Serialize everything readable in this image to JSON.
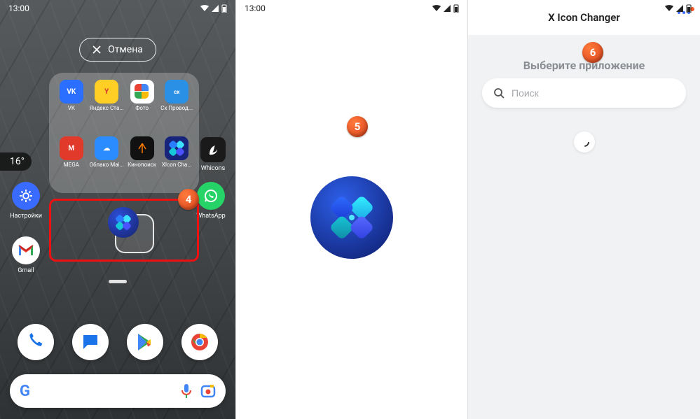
{
  "status": {
    "time": "13:00"
  },
  "panel1": {
    "cancel_label": "Отмена",
    "temperature": "16°",
    "folder_apps": [
      {
        "name": "VK",
        "bg": "#2a6fff"
      },
      {
        "name": "Яндекс Ста...",
        "bg": "#ffcf26"
      },
      {
        "name": "Фото",
        "bg": "#ffffff"
      },
      {
        "name": "Cx Провод...",
        "bg": "#2a90e6"
      },
      {
        "name": "MEGA",
        "bg": "#e23a2a"
      },
      {
        "name": "Облако Mai...",
        "bg": "#2a8cff"
      },
      {
        "name": "Кинопоиск",
        "bg": "#111111"
      },
      {
        "name": "XIcon Cha...",
        "bg": "#18247a"
      }
    ],
    "whicons_label": "Whicons",
    "left_apps": [
      {
        "name": "Настройки",
        "icon": "gear"
      },
      {
        "name": "Gmail",
        "icon": "gmail"
      }
    ],
    "whatsapp_label": "WhatsApp",
    "step4": "4"
  },
  "panel2": {
    "step5": "5"
  },
  "panel3": {
    "title": "X Icon Changer",
    "subtitle": "Выберите приложение",
    "search_placeholder": "Поиск",
    "step6": "6"
  }
}
